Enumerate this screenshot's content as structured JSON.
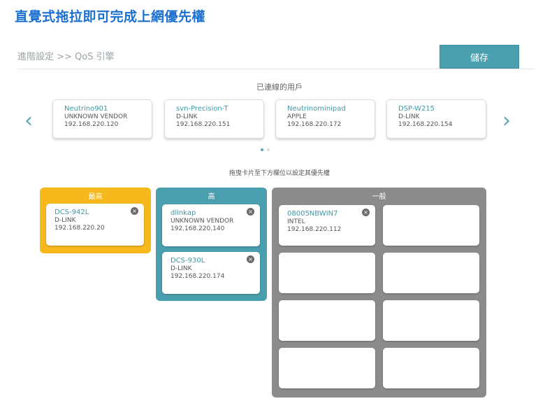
{
  "page": {
    "heading": "直覺式拖拉即可完成上網優先權"
  },
  "header": {
    "breadcrumb": "進階設定 >> QoS 引擎",
    "save_label": "儲存"
  },
  "connected": {
    "title": "已連線的用戶",
    "prev_arrow": "‹",
    "next_arrow": "›",
    "clients": [
      {
        "name": "Neutrino901",
        "vendor": "UNKNOWN VENDOR",
        "ip": "192.168.220.120"
      },
      {
        "name": "svn-Precision-T",
        "vendor": "D-LINK",
        "ip": "192.168.220.151"
      },
      {
        "name": "Neutrinominipad",
        "vendor": "APPLE",
        "ip": "192.168.220.172"
      },
      {
        "name": "DSP-W215",
        "vendor": "D-LINK",
        "ip": "192.168.220.154"
      }
    ],
    "pager": {
      "pages": 2,
      "current": 1
    }
  },
  "instruction": "拖曳卡片至下方欄位以設定其優先權",
  "priorities": {
    "highest": {
      "label": "最高",
      "color": "#f7b81c",
      "devices": [
        {
          "name": "DCS-942L",
          "vendor": "D-LINK",
          "ip": "192.168.220.20"
        }
      ]
    },
    "high": {
      "label": "高",
      "color": "#4a9fae",
      "devices": [
        {
          "name": "dlinkap",
          "vendor": "UNKNOWN VENDOR",
          "ip": "192.168.220.140"
        },
        {
          "name": "DCS-930L",
          "vendor": "D-LINK",
          "ip": "192.168.220.174"
        }
      ]
    },
    "normal": {
      "label": "一般",
      "color": "#8b8b8b",
      "devices": [
        {
          "name": "08005NBWIN7",
          "vendor": "INTEL",
          "ip": "192.168.220.112"
        }
      ],
      "empty_slots": 7
    }
  },
  "icons": {
    "remove": "close-circle-icon",
    "remove_glyph": "×"
  }
}
